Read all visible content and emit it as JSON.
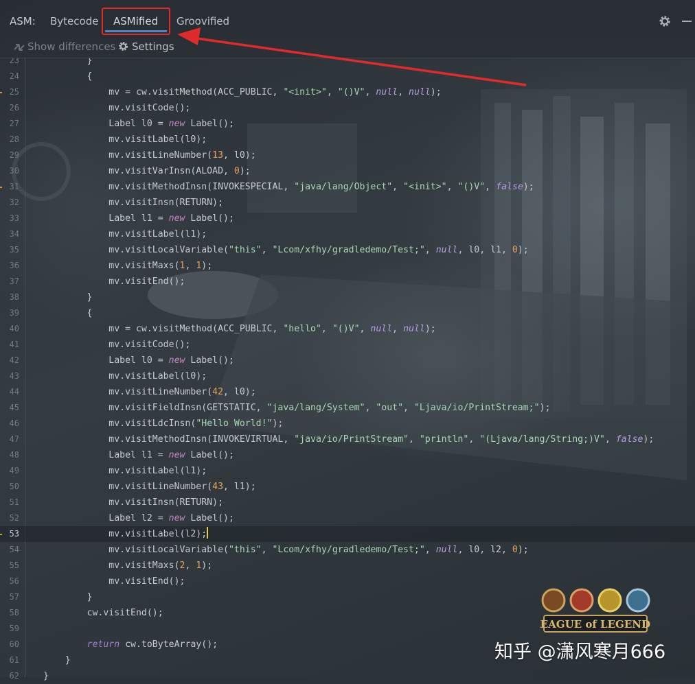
{
  "tabs_bar": {
    "prefix_label": "ASM:",
    "tabs": [
      {
        "label": "Bytecode",
        "active": false
      },
      {
        "label": "ASMified",
        "active": true
      },
      {
        "label": "Groovified",
        "active": false
      }
    ],
    "icons": [
      "gear-icon",
      "minimize-icon"
    ]
  },
  "sub_bar": {
    "show_differences_label": "Show differences",
    "show_differences_enabled": false,
    "settings_label": "Settings"
  },
  "editor": {
    "current_line": "53",
    "lines": [
      {
        "no": "23",
        "segs": [
          {
            "t": "        }",
            "c": ""
          }
        ]
      },
      {
        "no": "24",
        "segs": [
          {
            "t": "        {",
            "c": ""
          }
        ]
      },
      {
        "no": "25",
        "segs": [
          {
            "t": "            mv = cw.visitMethod(ACC_PUBLIC, ",
            "c": ""
          },
          {
            "t": "\"<init>\"",
            "c": "s-str"
          },
          {
            "t": ", ",
            "c": ""
          },
          {
            "t": "\"()V\"",
            "c": "s-str"
          },
          {
            "t": ", ",
            "c": ""
          },
          {
            "t": "null",
            "c": "s-null"
          },
          {
            "t": ", ",
            "c": ""
          },
          {
            "t": "null",
            "c": "s-null"
          },
          {
            "t": ");",
            "c": ""
          }
        ]
      },
      {
        "no": "26",
        "segs": [
          {
            "t": "            mv.visitCode();",
            "c": ""
          }
        ]
      },
      {
        "no": "27",
        "segs": [
          {
            "t": "            Label l0 = ",
            "c": ""
          },
          {
            "t": "new",
            "c": "s-kw"
          },
          {
            "t": " Label();",
            "c": ""
          }
        ]
      },
      {
        "no": "28",
        "segs": [
          {
            "t": "            mv.visitLabel(l0);",
            "c": ""
          }
        ]
      },
      {
        "no": "29",
        "segs": [
          {
            "t": "            mv.visitLineNumber(",
            "c": ""
          },
          {
            "t": "13",
            "c": "s-num"
          },
          {
            "t": ", l0);",
            "c": ""
          }
        ]
      },
      {
        "no": "30",
        "segs": [
          {
            "t": "            mv.visitVarInsn(ALOAD, ",
            "c": ""
          },
          {
            "t": "0",
            "c": "s-num"
          },
          {
            "t": ");",
            "c": ""
          }
        ]
      },
      {
        "no": "31",
        "segs": [
          {
            "t": "            mv.visitMethodInsn(INVOKESPECIAL, ",
            "c": ""
          },
          {
            "t": "\"java/lang/Object\"",
            "c": "s-str"
          },
          {
            "t": ", ",
            "c": ""
          },
          {
            "t": "\"<init>\"",
            "c": "s-str"
          },
          {
            "t": ", ",
            "c": ""
          },
          {
            "t": "\"()V\"",
            "c": "s-str"
          },
          {
            "t": ", ",
            "c": ""
          },
          {
            "t": "false",
            "c": "s-null"
          },
          {
            "t": ");",
            "c": ""
          }
        ]
      },
      {
        "no": "32",
        "segs": [
          {
            "t": "            mv.visitInsn(RETURN);",
            "c": ""
          }
        ]
      },
      {
        "no": "33",
        "segs": [
          {
            "t": "            Label l1 = ",
            "c": ""
          },
          {
            "t": "new",
            "c": "s-kw"
          },
          {
            "t": " Label();",
            "c": ""
          }
        ]
      },
      {
        "no": "34",
        "segs": [
          {
            "t": "            mv.visitLabel(l1);",
            "c": ""
          }
        ]
      },
      {
        "no": "35",
        "segs": [
          {
            "t": "            mv.visitLocalVariable(",
            "c": ""
          },
          {
            "t": "\"this\"",
            "c": "s-str"
          },
          {
            "t": ", ",
            "c": ""
          },
          {
            "t": "\"Lcom/xfhy/gradledemo/Test;\"",
            "c": "s-str"
          },
          {
            "t": ", ",
            "c": ""
          },
          {
            "t": "null",
            "c": "s-null"
          },
          {
            "t": ", l0, l1, ",
            "c": ""
          },
          {
            "t": "0",
            "c": "s-num"
          },
          {
            "t": ");",
            "c": ""
          }
        ]
      },
      {
        "no": "36",
        "segs": [
          {
            "t": "            mv.visitMaxs(",
            "c": ""
          },
          {
            "t": "1",
            "c": "s-num"
          },
          {
            "t": ", ",
            "c": ""
          },
          {
            "t": "1",
            "c": "s-num"
          },
          {
            "t": ");",
            "c": ""
          }
        ]
      },
      {
        "no": "37",
        "segs": [
          {
            "t": "            mv.visitEnd();",
            "c": ""
          }
        ]
      },
      {
        "no": "38",
        "segs": [
          {
            "t": "        }",
            "c": ""
          }
        ]
      },
      {
        "no": "39",
        "segs": [
          {
            "t": "        {",
            "c": ""
          }
        ]
      },
      {
        "no": "40",
        "segs": [
          {
            "t": "            mv = cw.visitMethod(ACC_PUBLIC, ",
            "c": ""
          },
          {
            "t": "\"hello\"",
            "c": "s-str"
          },
          {
            "t": ", ",
            "c": ""
          },
          {
            "t": "\"()V\"",
            "c": "s-str"
          },
          {
            "t": ", ",
            "c": ""
          },
          {
            "t": "null",
            "c": "s-null"
          },
          {
            "t": ", ",
            "c": ""
          },
          {
            "t": "null",
            "c": "s-null"
          },
          {
            "t": ");",
            "c": ""
          }
        ]
      },
      {
        "no": "41",
        "segs": [
          {
            "t": "            mv.visitCode();",
            "c": ""
          }
        ]
      },
      {
        "no": "42",
        "segs": [
          {
            "t": "            Label l0 = ",
            "c": ""
          },
          {
            "t": "new",
            "c": "s-kw"
          },
          {
            "t": " Label();",
            "c": ""
          }
        ]
      },
      {
        "no": "43",
        "segs": [
          {
            "t": "            mv.visitLabel(l0);",
            "c": ""
          }
        ]
      },
      {
        "no": "44",
        "segs": [
          {
            "t": "            mv.visitLineNumber(",
            "c": ""
          },
          {
            "t": "42",
            "c": "s-num"
          },
          {
            "t": ", l0);",
            "c": ""
          }
        ]
      },
      {
        "no": "45",
        "segs": [
          {
            "t": "            mv.visitFieldInsn(GETSTATIC, ",
            "c": ""
          },
          {
            "t": "\"java/lang/System\"",
            "c": "s-str"
          },
          {
            "t": ", ",
            "c": ""
          },
          {
            "t": "\"out\"",
            "c": "s-str"
          },
          {
            "t": ", ",
            "c": ""
          },
          {
            "t": "\"Ljava/io/PrintStream;\"",
            "c": "s-str"
          },
          {
            "t": ");",
            "c": ""
          }
        ]
      },
      {
        "no": "46",
        "segs": [
          {
            "t": "            mv.visitLdcInsn(",
            "c": ""
          },
          {
            "t": "\"Hello World!\"",
            "c": "s-str"
          },
          {
            "t": ");",
            "c": ""
          }
        ]
      },
      {
        "no": "47",
        "segs": [
          {
            "t": "            mv.visitMethodInsn(INVOKEVIRTUAL, ",
            "c": ""
          },
          {
            "t": "\"java/io/PrintStream\"",
            "c": "s-str"
          },
          {
            "t": ", ",
            "c": ""
          },
          {
            "t": "\"println\"",
            "c": "s-str"
          },
          {
            "t": ", ",
            "c": ""
          },
          {
            "t": "\"(Ljava/lang/String;)V\"",
            "c": "s-str"
          },
          {
            "t": ", ",
            "c": ""
          },
          {
            "t": "false",
            "c": "s-null"
          },
          {
            "t": ");",
            "c": ""
          }
        ]
      },
      {
        "no": "48",
        "segs": [
          {
            "t": "            Label l1 = ",
            "c": ""
          },
          {
            "t": "new",
            "c": "s-kw"
          },
          {
            "t": " Label();",
            "c": ""
          }
        ]
      },
      {
        "no": "49",
        "segs": [
          {
            "t": "            mv.visitLabel(l1);",
            "c": ""
          }
        ]
      },
      {
        "no": "50",
        "segs": [
          {
            "t": "            mv.visitLineNumber(",
            "c": ""
          },
          {
            "t": "43",
            "c": "s-num"
          },
          {
            "t": ", l1);",
            "c": ""
          }
        ]
      },
      {
        "no": "51",
        "segs": [
          {
            "t": "            mv.visitInsn(RETURN);",
            "c": ""
          }
        ]
      },
      {
        "no": "52",
        "segs": [
          {
            "t": "            Label l2 = ",
            "c": ""
          },
          {
            "t": "new",
            "c": "s-kw"
          },
          {
            "t": " Label();",
            "c": ""
          }
        ]
      },
      {
        "no": "53",
        "segs": [
          {
            "t": "            mv.visitLabel(l2);",
            "c": ""
          }
        ]
      },
      {
        "no": "54",
        "segs": [
          {
            "t": "            mv.visitLocalVariable(",
            "c": ""
          },
          {
            "t": "\"this\"",
            "c": "s-str"
          },
          {
            "t": ", ",
            "c": ""
          },
          {
            "t": "\"Lcom/xfhy/gradledemo/Test;\"",
            "c": "s-str"
          },
          {
            "t": ", ",
            "c": ""
          },
          {
            "t": "null",
            "c": "s-null"
          },
          {
            "t": ", l0, l2, ",
            "c": ""
          },
          {
            "t": "0",
            "c": "s-num"
          },
          {
            "t": ");",
            "c": ""
          }
        ]
      },
      {
        "no": "55",
        "segs": [
          {
            "t": "            mv.visitMaxs(",
            "c": ""
          },
          {
            "t": "2",
            "c": "s-num"
          },
          {
            "t": ", ",
            "c": ""
          },
          {
            "t": "1",
            "c": "s-num"
          },
          {
            "t": ");",
            "c": ""
          }
        ]
      },
      {
        "no": "56",
        "segs": [
          {
            "t": "            mv.visitEnd();",
            "c": ""
          }
        ]
      },
      {
        "no": "57",
        "segs": [
          {
            "t": "        }",
            "c": ""
          }
        ]
      },
      {
        "no": "58",
        "segs": [
          {
            "t": "        cw.visitEnd();",
            "c": ""
          }
        ]
      },
      {
        "no": "59",
        "segs": [
          {
            "t": "",
            "c": ""
          }
        ]
      },
      {
        "no": "60",
        "segs": [
          {
            "t": "        ",
            "c": ""
          },
          {
            "t": "return",
            "c": "s-ret"
          },
          {
            "t": " cw.toByteArray();",
            "c": ""
          }
        ]
      },
      {
        "no": "61",
        "segs": [
          {
            "t": "    }",
            "c": ""
          }
        ]
      },
      {
        "no": "62",
        "segs": [
          {
            "t": "}",
            "c": ""
          }
        ]
      }
    ]
  },
  "watermark": {
    "logo_text": "LEAGUE of LEGENDS",
    "text": "知乎 @潇风寒月666"
  },
  "colors": {
    "annotation_red": "#e02b2b",
    "active_tab_underline": "#4a88c7",
    "caret": "#e8c94a"
  }
}
